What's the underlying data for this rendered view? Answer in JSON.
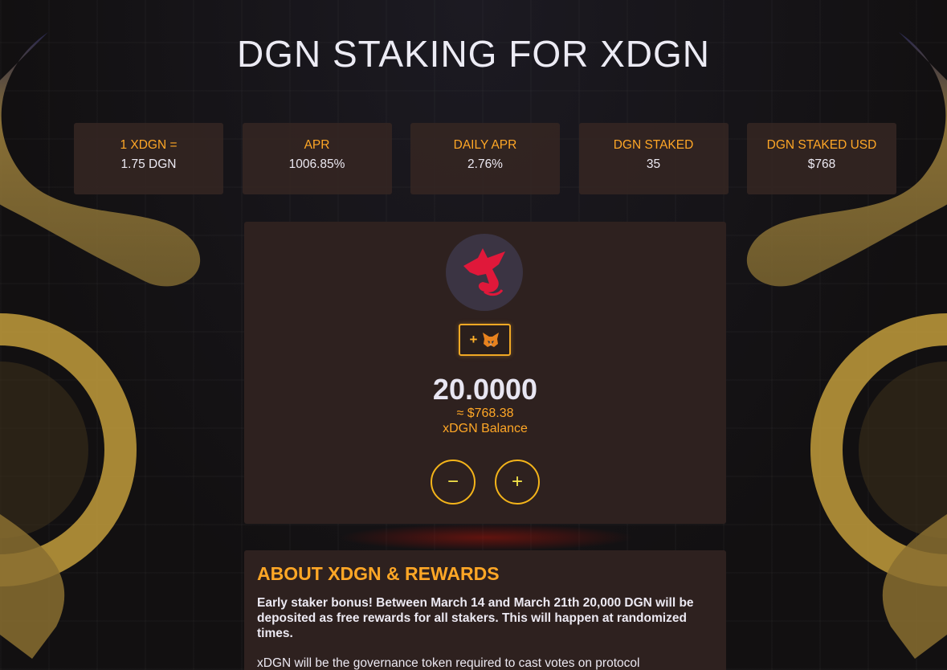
{
  "page": {
    "title": "DGN STAKING FOR XDGN"
  },
  "stats": [
    {
      "label": "1 XDGN =",
      "value": "1.75 DGN"
    },
    {
      "label": "APR",
      "value": "1006.85%"
    },
    {
      "label": "DAILY APR",
      "value": "2.76%"
    },
    {
      "label": "DGN STAKED",
      "value": "35"
    },
    {
      "label": "DGN STAKED USD",
      "value": "$768"
    }
  ],
  "wallet": {
    "add_button_prefix": "+",
    "add_button_icon": "metamask-fox-icon",
    "token_logo_icon": "red-dragon-logo"
  },
  "balance": {
    "amount": "20.0000",
    "usd": "≈ $768.38",
    "label": "xDGN Balance"
  },
  "controls": {
    "minus": "−",
    "plus": "+"
  },
  "about": {
    "title": "ABOUT XDGN & REWARDS",
    "paragraph1": "Early staker bonus! Between March 14 and March 21th 20,000 DGN will be deposited as free rewards for all stakers. This will happen at randomized times.",
    "paragraph2": "xDGN will be the governance token required to cast votes on protocol"
  },
  "colors": {
    "accent": "#ffa726",
    "card_bg": "#2e211f",
    "button_border": "#f4b41a",
    "dragon_gold": "#b8953a"
  }
}
